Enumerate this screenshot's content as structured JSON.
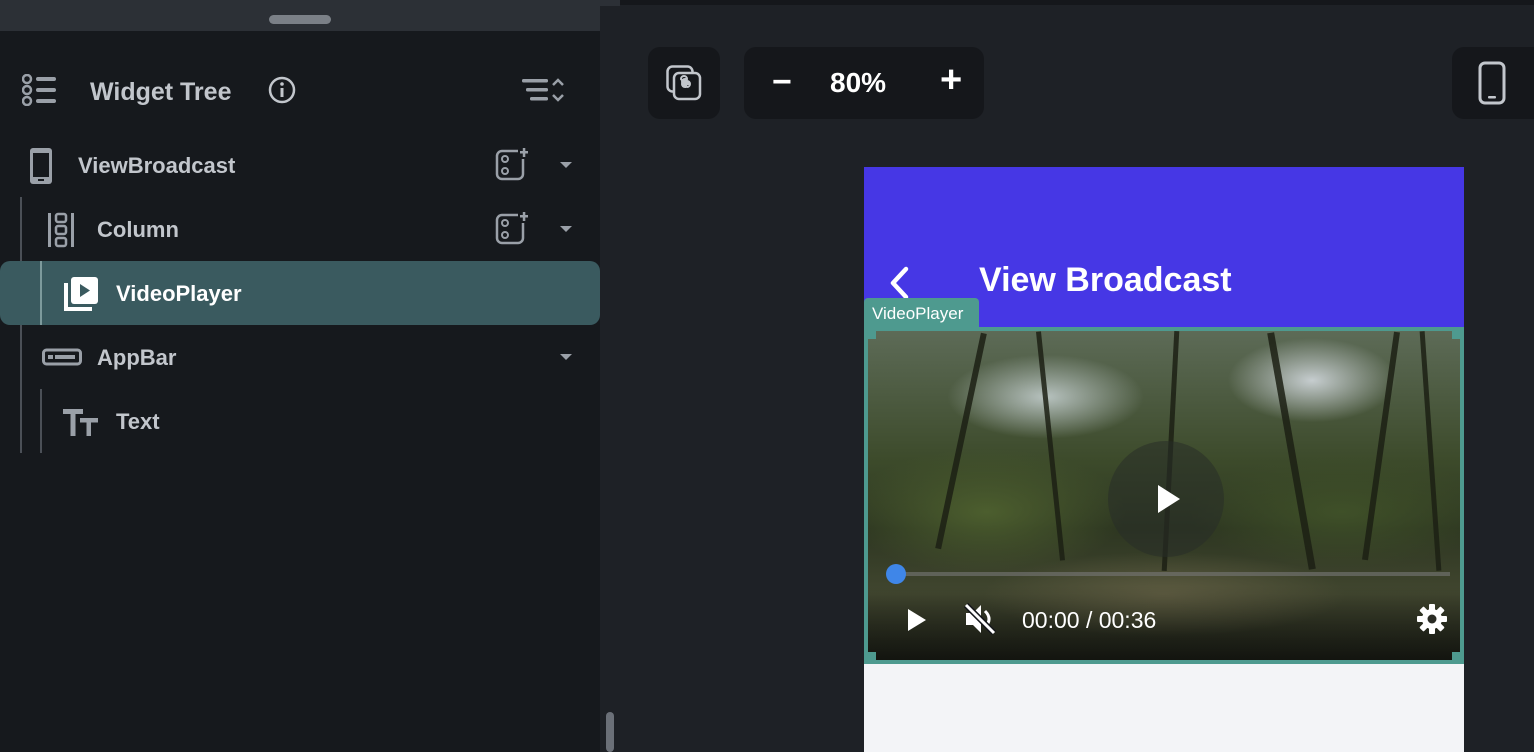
{
  "panel": {
    "title": "Widget Tree",
    "tree": [
      {
        "label": "ViewBroadcast",
        "icon": "phone-icon",
        "has_add": true,
        "has_caret": true
      },
      {
        "label": "Column",
        "icon": "column-icon",
        "has_add": true,
        "has_caret": true
      },
      {
        "label": "VideoPlayer",
        "icon": "video-library-icon",
        "selected": true
      },
      {
        "label": "AppBar",
        "icon": "appbar-icon",
        "has_caret": true
      },
      {
        "label": "Text",
        "icon": "text-icon"
      }
    ]
  },
  "toolbar": {
    "zoom": "80%",
    "zoom_out": "−",
    "zoom_in": "+"
  },
  "preview": {
    "appbar_title": "View Broadcast",
    "selected_tag": "VideoPlayer",
    "video": {
      "time": "00:00 / 00:36",
      "progress": 0,
      "muted": true
    }
  },
  "colors": {
    "appbar": "#4637e5",
    "selection": "#4e9a8f",
    "selected_row": "#3a5a5f",
    "progress_dot": "#3f86e8"
  }
}
